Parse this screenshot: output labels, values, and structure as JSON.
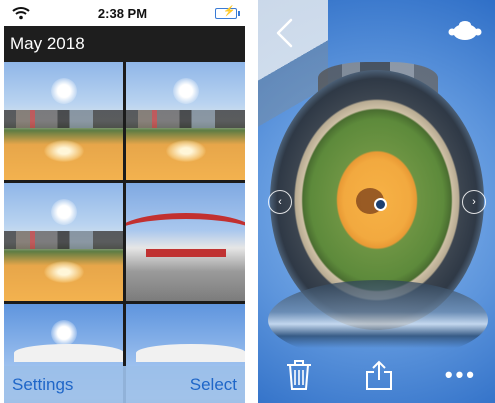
{
  "status_bar": {
    "time": "2:38 PM"
  },
  "gallery": {
    "album_title": "May 2018",
    "bottom_bar": {
      "settings_label": "Settings",
      "select_label": "Select"
    }
  },
  "viewer": {
    "more_label": "•••"
  },
  "icons": {
    "wifi": "wifi-icon",
    "battery": "battery-icon",
    "back": "chevron-left-icon",
    "vr": "vr-headset-icon",
    "trash": "trash-icon",
    "share": "share-icon",
    "more": "more-icon",
    "nav_left": "chevron-left-circle-icon",
    "nav_right": "chevron-right-circle-icon"
  },
  "colors": {
    "accent": "#1f66c8",
    "toolbar_bg": "#9bbfe9",
    "header_bg": "#1e1e1e"
  }
}
